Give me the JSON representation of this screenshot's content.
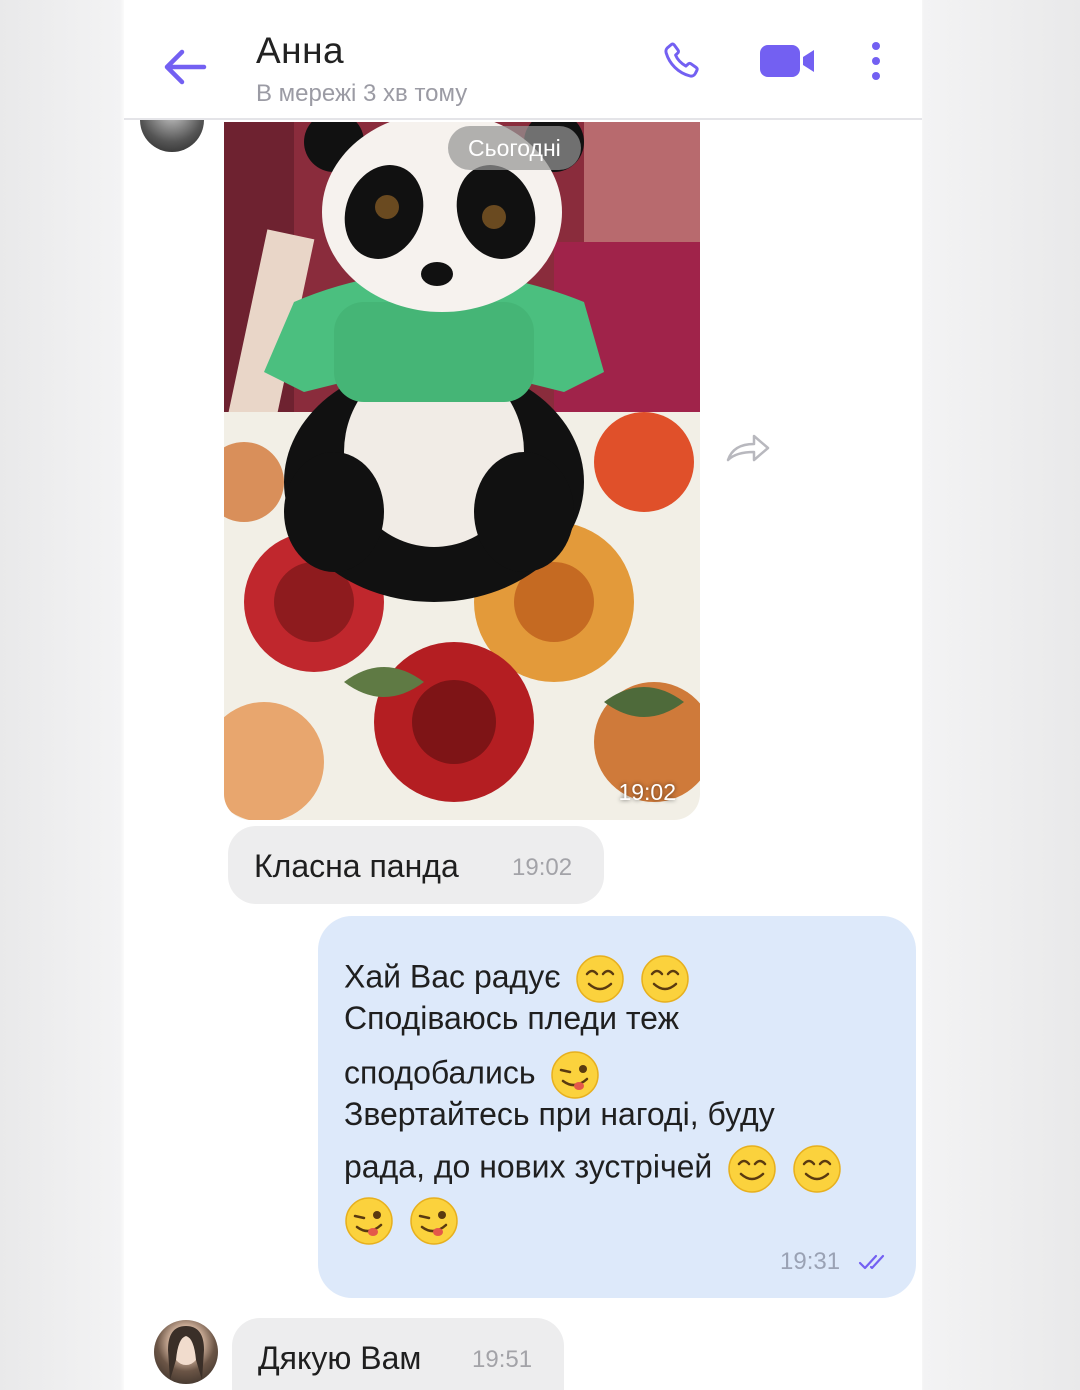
{
  "header": {
    "contact_name": "Анна",
    "status": "В мережі 3 хв тому",
    "icons": [
      "back-arrow-icon",
      "phone-icon",
      "video-camera-icon",
      "more-vertical-icon"
    ],
    "accent_color": "#7360f2"
  },
  "chat": {
    "date_chip": "Сьогодні",
    "photo_message": {
      "time": "19:02"
    },
    "incoming_1": {
      "text": "Класна панда",
      "time": "19:02"
    },
    "outgoing": {
      "lines": [
        "Хай Вас радує",
        "Сподіваюсь пледи теж",
        "сподобались",
        "Звертайтесь при нагоді, буду",
        "рада, до нових зустрічей"
      ],
      "emojis": [
        "smiling-face-emoji",
        "winking-tongue-face-emoji"
      ],
      "time": "19:31",
      "status": "read"
    },
    "incoming_2": {
      "text": "Дякую Вам",
      "time": "19:51"
    }
  },
  "colors": {
    "incoming_bubble": "#ededee",
    "outgoing_bubble": "#dde9fa"
  }
}
